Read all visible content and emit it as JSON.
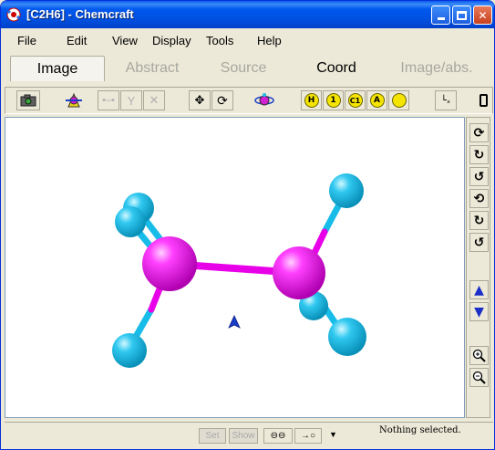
{
  "window": {
    "title": "[C2H6] - Chemcraft",
    "title_icon": "chemcraft-logo-icon",
    "controls": [
      "minimize-icon",
      "maximize-icon",
      "close-icon"
    ]
  },
  "menu": {
    "items": [
      "File",
      "Edit",
      "View",
      "Display",
      "Tools",
      "Help"
    ]
  },
  "tabs": [
    {
      "label": "Image",
      "state": "active"
    },
    {
      "label": "Abstract",
      "state": "disabled"
    },
    {
      "label": "Source",
      "state": "disabled"
    },
    {
      "label": "Coord",
      "state": "enabled"
    },
    {
      "label": "Image/abs.",
      "state": "disabled"
    }
  ],
  "toolbar": {
    "icons": [
      "camera-icon",
      "shape-icon",
      "atom-bond-icon",
      "branch-icon",
      "cross-icon",
      "fit-view-icon",
      "refresh-view-icon",
      "orbit-icon"
    ],
    "label_buttons": [
      "H",
      "1",
      "C1",
      "A",
      ""
    ],
    "extra_icons": [
      "axis-icon",
      "copy-icon"
    ]
  },
  "molecule": {
    "name": "C2H6",
    "carbon_color": "#e800e8",
    "hydrogen_color": "#1ec0e8",
    "bond_color": "#e800e8",
    "marker_icon": "arrow-cursor-icon"
  },
  "right_tools": [
    "rotate-1-icon",
    "rotate-2-icon",
    "rotate-3-icon",
    "rotate-4-icon",
    "rotate-5-icon",
    "rotate-6-icon",
    "move-up-icon",
    "move-down-icon",
    "zoom-in-icon",
    "zoom-out-icon"
  ],
  "statusbar": {
    "set_label": "Set",
    "show_label": "Show",
    "status_text": "Nothing selected."
  }
}
